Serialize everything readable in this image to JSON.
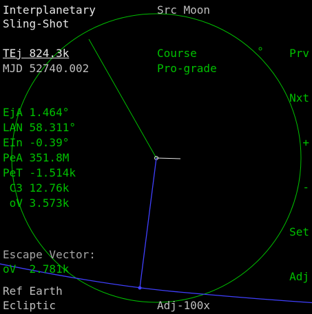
{
  "header": {
    "title_line1": "Interplanetary",
    "title_line2": "Sling-Shot",
    "source": "Src Moon"
  },
  "ejection": {
    "tej": "TEj 824.3k",
    "mjd": "MJD 52740.002"
  },
  "course": {
    "label": "Course",
    "mode": "Pro-grade"
  },
  "orbit_params": [
    "EjA 1.464°",
    "LAN 58.311°",
    "EIn -0.39°",
    "PeA 351.8M",
    "PeT -1.514k",
    " C3 12.76k",
    " oV 3.573k"
  ],
  "escape": {
    "label": "Escape Vector:",
    "value": "oV  2.781k"
  },
  "reference": {
    "ref": "Ref Earth",
    "frame": "Ecliptic"
  },
  "adjust": {
    "step": "Adj-100x"
  },
  "buttons": {
    "prv": "Prv",
    "nxt": "Nxt",
    "plus": "+",
    "minus": "-",
    "set": "Set",
    "adj": "Adj"
  },
  "colors": {
    "background": "#000000",
    "orbit": "#00c000",
    "vector": "#4040ff",
    "text_white": "#e6e6e6"
  }
}
